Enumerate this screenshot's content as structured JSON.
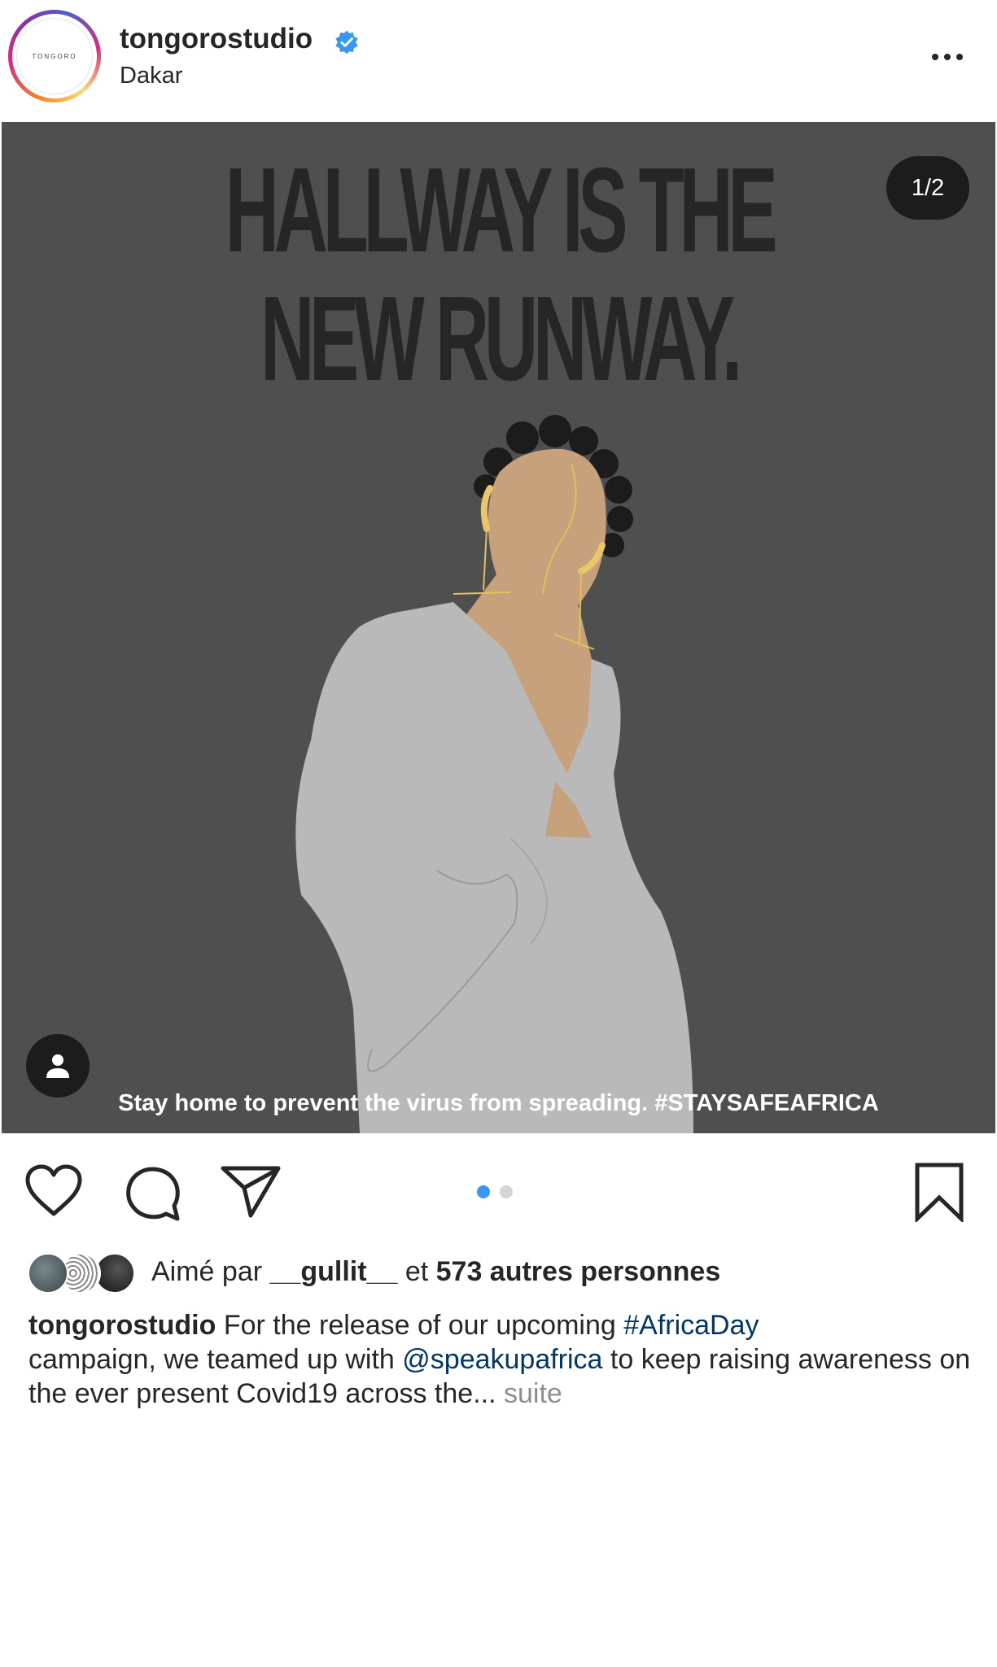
{
  "header": {
    "username": "tongorostudio",
    "location": "Dakar",
    "avatar_text": "TONGORO",
    "verified_color": "#3897f0"
  },
  "post": {
    "headline_line1": "HALLWAY IS THE",
    "headline_line2": "NEW RUNWAY.",
    "page_counter": "1/2",
    "image_caption": "Stay home to prevent the virus from spreading. #STAYSAFEAFRICA",
    "background_color": "#4f4f4f",
    "carousel": {
      "total": 2,
      "active": 1
    }
  },
  "actions": {
    "like_icon": "heart-icon",
    "comment_icon": "comment-icon",
    "share_icon": "paper-plane-icon",
    "save_icon": "bookmark-icon"
  },
  "likes": {
    "prefix": "Aimé par",
    "first_user": "__gullit__",
    "connector": "et",
    "others": "573 autres personnes"
  },
  "caption": {
    "username": "tongorostudio",
    "part1": "For the release of our upcoming",
    "hashtag": "#AfricaDay",
    "part2": "campaign, we teamed up with",
    "mention": "@speakupafrica",
    "part3": "to keep raising awareness on the ever present Covid19 across the...",
    "more": "suite"
  }
}
